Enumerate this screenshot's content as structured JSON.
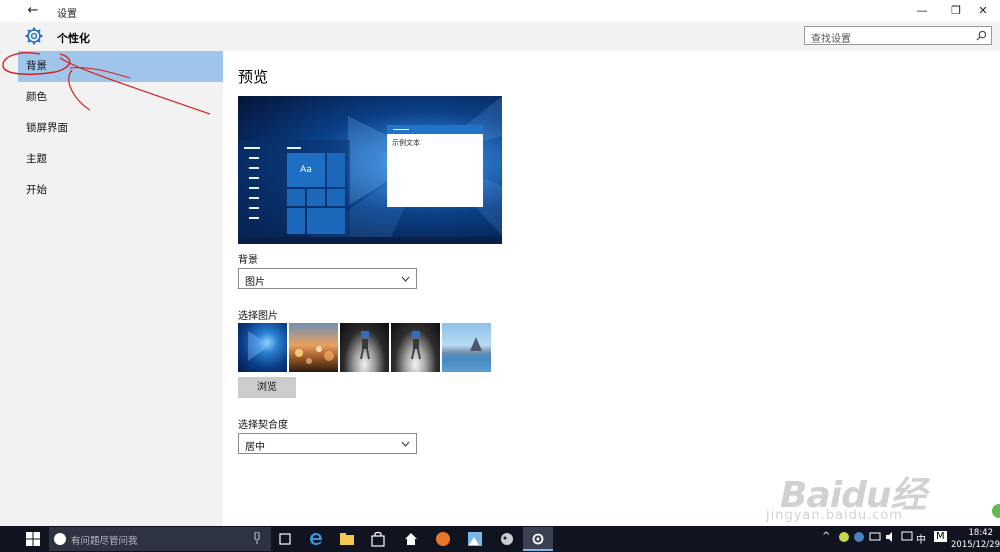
{
  "window": {
    "title": "设置",
    "back_glyph": "←",
    "min_glyph": "—",
    "max_glyph": "❐",
    "close_glyph": "✕"
  },
  "app": {
    "title": "个性化"
  },
  "nav": {
    "items": [
      {
        "label": "背景"
      },
      {
        "label": "颜色"
      },
      {
        "label": "锁屏界面"
      },
      {
        "label": "主题"
      },
      {
        "label": "开始"
      }
    ],
    "active_index": 0
  },
  "search": {
    "placeholder": "查找设置"
  },
  "preview": {
    "title": "预览",
    "tile_text": "Aa",
    "window_text": "示例文本"
  },
  "background": {
    "label": "背景",
    "value": "图片"
  },
  "choose_picture": {
    "label": "选择图片",
    "browse_label": "浏览"
  },
  "fit": {
    "label": "选择契合度",
    "value": "居中"
  },
  "taskbar": {
    "search_placeholder": "有问题尽管问我",
    "ime": "中",
    "ime2": "M",
    "time": "18:42",
    "date": "2015/12/29"
  },
  "watermark": {
    "brand": "Baidu经验",
    "url": "jingyan.baidu.com"
  },
  "colors": {
    "accent": "#9fc6ea",
    "taskbar": "#0f1420",
    "preview_blue": "#1e6fc4"
  }
}
